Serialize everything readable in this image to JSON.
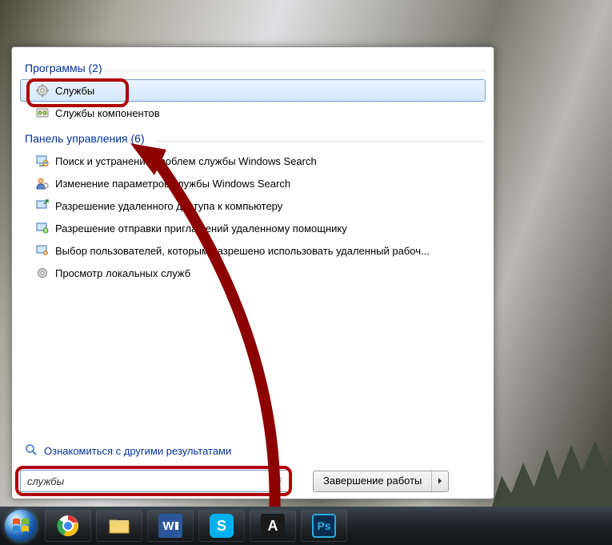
{
  "start_menu": {
    "sections": {
      "programs": {
        "header": "Программы (2)"
      },
      "control_panel": {
        "header": "Панель управления (6)"
      }
    },
    "programs_items": [
      {
        "label": "Службы",
        "selected": true
      },
      {
        "label": "Службы компонентов",
        "selected": false
      }
    ],
    "control_panel_items": [
      {
        "label": "Поиск и устранение проблем службы Windows Search"
      },
      {
        "label": "Изменение параметров службы Windows Search"
      },
      {
        "label": "Разрешение удаленного доступа к компьютеру"
      },
      {
        "label": "Разрешение отправки приглашений удаленному помощнику"
      },
      {
        "label": "Выбор пользователей, которым разрешено использовать удаленный рабоч..."
      },
      {
        "label": "Просмотр локальных служб"
      }
    ],
    "see_more": "Ознакомиться с другими результатами",
    "search_value": "службы",
    "shutdown_label": "Завершение работы"
  },
  "taskbar": {
    "apps": [
      "chrome",
      "explorer",
      "word",
      "skype",
      "autocad",
      "photoshop"
    ]
  }
}
